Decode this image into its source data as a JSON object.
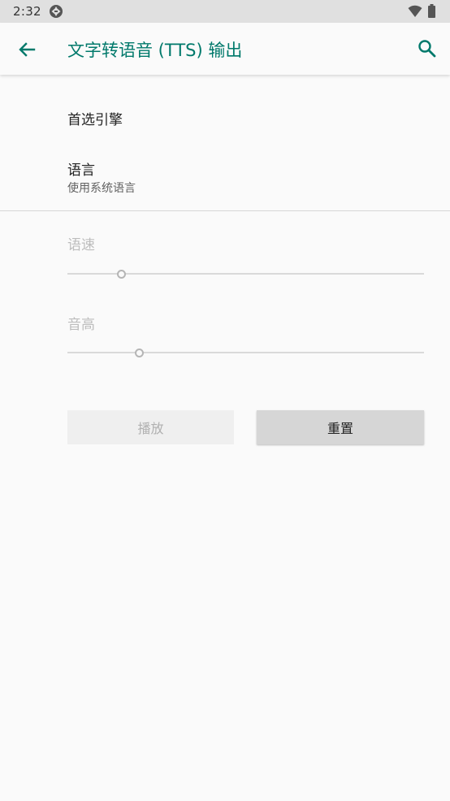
{
  "status_bar": {
    "time": "2:32",
    "icons": [
      "app-notification-icon",
      "wifi-icon",
      "battery-icon"
    ]
  },
  "app_bar": {
    "title": "文字转语音 (TTS) 输出",
    "accent_color": "#00796b",
    "icons": [
      "back-arrow-icon",
      "search-icon"
    ]
  },
  "preferences": {
    "engine": {
      "title": "首选引擎"
    },
    "language": {
      "title": "语言",
      "summary": "使用系统语言"
    }
  },
  "sliders": {
    "speech_rate": {
      "label": "语速",
      "value_fraction": 0.15,
      "enabled": false
    },
    "pitch": {
      "label": "音高",
      "value_fraction": 0.2,
      "enabled": false
    }
  },
  "buttons": {
    "play": {
      "label": "播放",
      "enabled": false
    },
    "reset": {
      "label": "重置",
      "enabled": true
    }
  }
}
